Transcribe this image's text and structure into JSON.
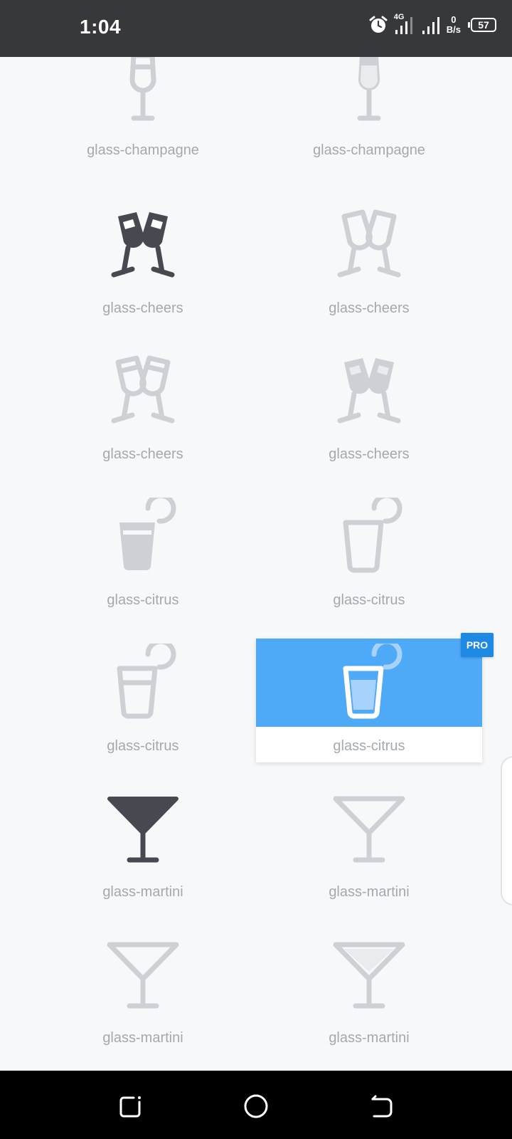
{
  "status_bar": {
    "time": "1:04",
    "network": "4G",
    "speed_value": "0",
    "speed_unit": "B/s",
    "battery": "57"
  },
  "colors": {
    "dark_icon": "#464a50",
    "light_icon": "#cdd1d6",
    "selected_bg": "#4ea9f6",
    "pro_badge": "#1e88e5"
  },
  "icons": [
    {
      "label": "glass-champagne",
      "icon": "glass-champagne-icon",
      "style": "light"
    },
    {
      "label": "glass-champagne",
      "icon": "glass-champagne-icon",
      "style": "duotone"
    },
    {
      "label": "glass-cheers",
      "icon": "glass-cheers-icon",
      "style": "solid"
    },
    {
      "label": "glass-cheers",
      "icon": "glass-cheers-icon",
      "style": "regular"
    },
    {
      "label": "glass-cheers",
      "icon": "glass-cheers-icon",
      "style": "light"
    },
    {
      "label": "glass-cheers",
      "icon": "glass-cheers-icon",
      "style": "duotone"
    },
    {
      "label": "glass-citrus",
      "icon": "glass-citrus-icon",
      "style": "solid"
    },
    {
      "label": "glass-citrus",
      "icon": "glass-citrus-icon",
      "style": "regular"
    },
    {
      "label": "glass-citrus",
      "icon": "glass-citrus-icon",
      "style": "light"
    },
    {
      "label": "glass-citrus",
      "icon": "glass-citrus-icon",
      "style": "duotone",
      "selected": true,
      "badge": "PRO"
    },
    {
      "label": "glass-martini",
      "icon": "glass-martini-icon",
      "style": "solid"
    },
    {
      "label": "glass-martini",
      "icon": "glass-martini-icon",
      "style": "regular"
    },
    {
      "label": "glass-martini",
      "icon": "glass-martini-icon",
      "style": "light"
    },
    {
      "label": "glass-martini",
      "icon": "glass-martini-icon",
      "style": "duotone"
    }
  ]
}
